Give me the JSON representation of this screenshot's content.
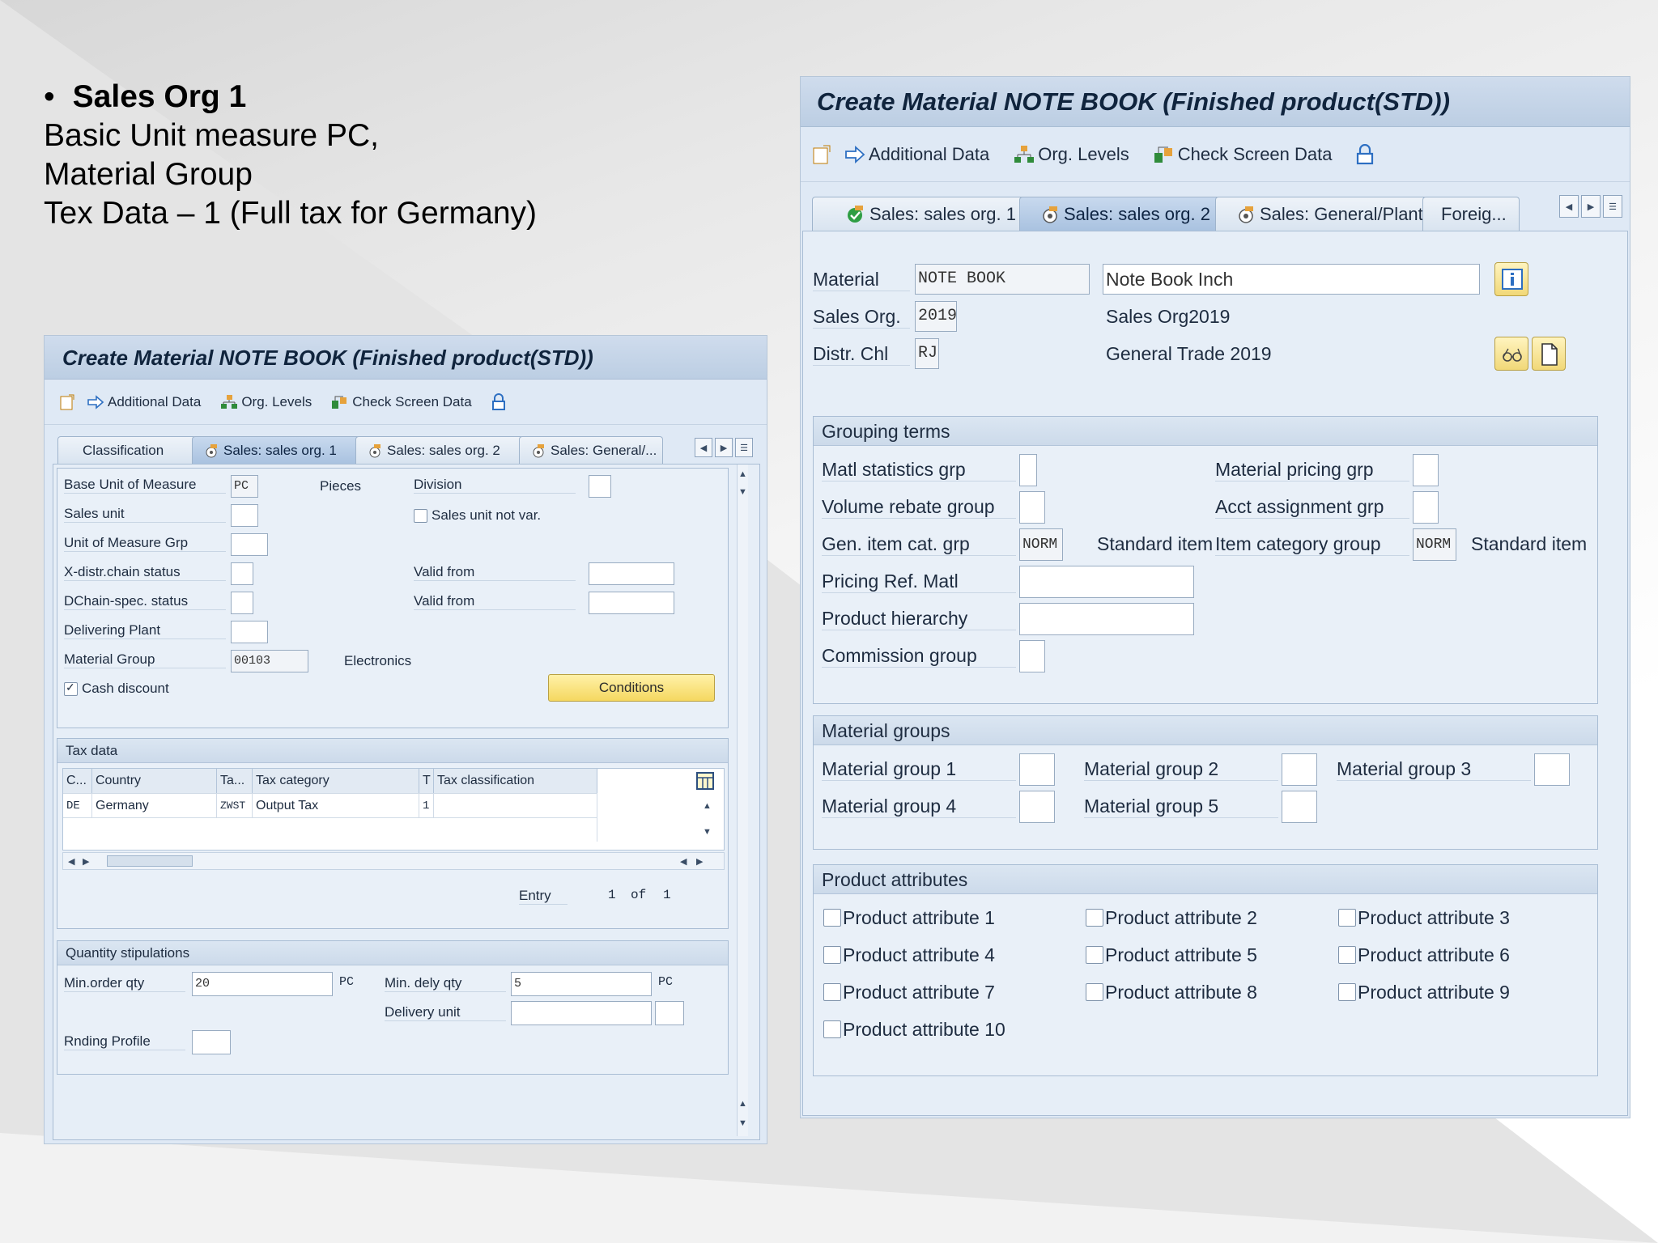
{
  "slide": {
    "bullet": "•",
    "heading": "Sales Org 1",
    "line1": "Basic Unit measure PC,",
    "line2": "Material Group",
    "line3": "Tex Data – 1 (Full tax for Germany)"
  },
  "left": {
    "title": "Create Material NOTE BOOK (Finished product(STD))",
    "toolbar": {
      "additional_data": "Additional Data",
      "org_levels": "Org. Levels",
      "check_screen_data": "Check Screen Data"
    },
    "tabs": [
      "Classification",
      "Sales: sales org. 1",
      "Sales: sales org. 2",
      "Sales: General/..."
    ],
    "fields": {
      "base_uom_label": "Base Unit of Measure",
      "base_uom_value": "PC",
      "base_uom_text": "Pieces",
      "division_label": "Division",
      "sales_unit_label": "Sales unit",
      "sales_unit_not_var": "Sales unit not var.",
      "uom_grp_label": "Unit of Measure Grp",
      "xdistr_label": "X-distr.chain status",
      "valid_from_1": "Valid from",
      "dchain_label": "DChain-spec. status",
      "valid_from_2": "Valid from",
      "delivering_plant_label": "Delivering Plant",
      "material_group_label": "Material Group",
      "material_group_value": "00103",
      "material_group_text": "Electronics",
      "cash_discount_label": "Cash discount",
      "conditions_button": "Conditions"
    },
    "tax": {
      "title": "Tax data",
      "headers": [
        "C...",
        "Country",
        "Ta...",
        "Tax category",
        "T",
        "Tax classification"
      ],
      "rows": [
        [
          "DE",
          "Germany",
          "ZWST",
          "Output Tax",
          "1",
          ""
        ]
      ],
      "entry_label": "Entry",
      "entry_current": "1",
      "of_label": "of",
      "entry_total": "1"
    },
    "quantity": {
      "title": "Quantity stipulations",
      "min_order_label": "Min.order qty",
      "min_order_value": "20",
      "min_order_unit": "PC",
      "min_dely_label": "Min. dely qty",
      "min_dely_value": "5",
      "min_dely_unit": "PC",
      "delivery_unit_label": "Delivery unit",
      "rnding_label": "Rnding Profile"
    }
  },
  "right": {
    "title": "Create Material NOTE BOOK (Finished product(STD))",
    "toolbar": {
      "additional_data": "Additional Data",
      "org_levels": "Org. Levels",
      "check_screen_data": "Check Screen Data"
    },
    "tabs": [
      "Sales: sales org. 1",
      "Sales: sales org. 2",
      "Sales: General/Plant",
      "Foreig..."
    ],
    "header": {
      "material_label": "Material",
      "material_value": "NOTE BOOK",
      "material_desc": "Note Book Inch",
      "sales_org_label": "Sales Org.",
      "sales_org_value": "2019",
      "sales_org_text": "Sales Org2019",
      "distr_chl_label": "Distr. Chl",
      "distr_chl_value": "RJ",
      "distr_chl_text": "General Trade 2019"
    },
    "grouping": {
      "title": "Grouping terms",
      "matl_stat": "Matl statistics grp",
      "mat_pricing": "Material pricing grp",
      "vol_rebate": "Volume rebate group",
      "acct_assign": "Acct assignment grp",
      "gen_item_cat": "Gen. item cat. grp",
      "gen_item_cat_value": "NORM",
      "gen_item_cat_text": "Standard item",
      "item_cat_group": "Item category group",
      "item_cat_group_value": "NORM",
      "item_cat_group_text": "Standard item",
      "pricing_ref": "Pricing Ref. Matl",
      "product_hierarchy": "Product hierarchy",
      "commission_group": "Commission group"
    },
    "material_groups": {
      "title": "Material groups",
      "items": [
        "Material group 1",
        "Material group 2",
        "Material group 3",
        "Material group 4",
        "Material group 5"
      ]
    },
    "product_attributes": {
      "title": "Product attributes",
      "items": [
        "Product attribute 1",
        "Product attribute 2",
        "Product attribute 3",
        "Product attribute 4",
        "Product attribute 5",
        "Product attribute 6",
        "Product attribute 7",
        "Product attribute 8",
        "Product attribute 9",
        "Product attribute 10"
      ]
    }
  }
}
